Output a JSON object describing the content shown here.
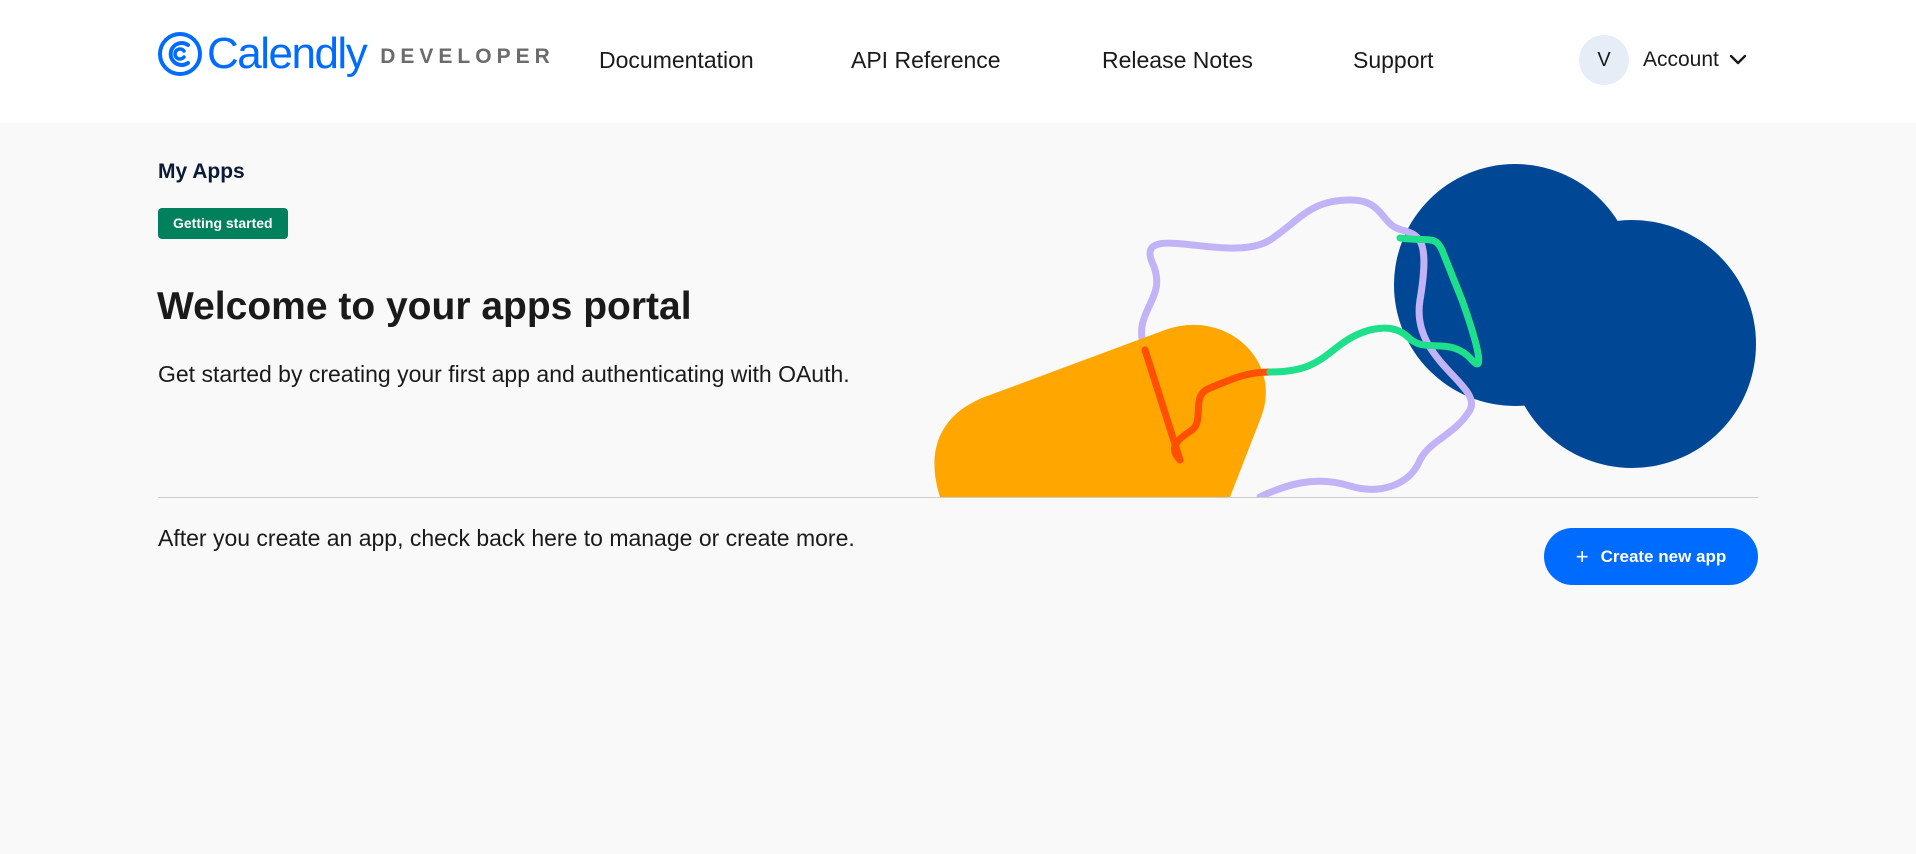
{
  "header": {
    "logo_text": "Calendly",
    "logo_subtext": "DEVELOPER",
    "nav": [
      {
        "label": "Documentation"
      },
      {
        "label": "API Reference"
      },
      {
        "label": "Release Notes"
      },
      {
        "label": "Support"
      }
    ],
    "account": {
      "avatar_initial": "V",
      "label": "Account",
      "icon": "chevron-down-icon"
    }
  },
  "main": {
    "section_title": "My Apps",
    "badge": "Getting started",
    "heading": "Welcome to your apps portal",
    "subtitle": "Get started by creating your first app and authenticating with OAuth.",
    "after_text": "After you create an app, check back here to manage or create more.",
    "create_button": {
      "label": "Create new app",
      "icon": "plus-icon"
    }
  },
  "colors": {
    "brand_blue": "#006bff",
    "badge_green": "#00805c",
    "navy": "#004796",
    "orange": "#ffa600",
    "red_line": "#ff4f00",
    "green_line": "#1fe08a",
    "lavender_line": "#c2b3f7",
    "background": "#f9f9f9"
  }
}
